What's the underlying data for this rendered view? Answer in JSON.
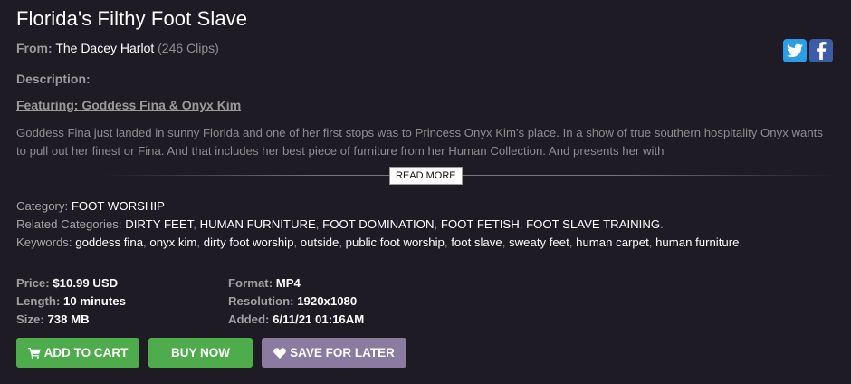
{
  "title": "Florida's Filthy Foot Slave",
  "from": {
    "label": "From:",
    "studio": "The Dacey Harlot",
    "clips": "(246 Clips)"
  },
  "social": {
    "twitter_icon": "twitter-icon",
    "facebook_icon": "facebook-icon"
  },
  "description": {
    "label": "Description:",
    "featuring": "Featuring: Goddess Fina & Onyx Kim",
    "text": "Goddess Fina just landed in sunny Florida and one of her first stops was to Princess Onyx Kim's place.  In a show of true southern hospitality Onyx wants to pull out her finest or Fina.  And that includes her best piece of furniture from her Human Collection.  And presents her with",
    "read_more": "READ MORE"
  },
  "category": {
    "label": "Category:",
    "value": "FOOT WORSHIP"
  },
  "related": {
    "label": "Related Categories:",
    "items": [
      "DIRTY FEET",
      "HUMAN FURNITURE",
      "FOOT DOMINATION",
      "FOOT FETISH",
      "FOOT SLAVE TRAINING"
    ]
  },
  "keywords": {
    "label": "Keywords:",
    "items": [
      "goddess fina",
      "onyx kim",
      "dirty foot worship",
      "outside",
      "public foot worship",
      "foot slave",
      "sweaty feet",
      "human carpet",
      "human furniture"
    ]
  },
  "info": {
    "price_label": "Price:",
    "price": "$10.99 USD",
    "length_label": "Length:",
    "length": "10 minutes",
    "size_label": "Size:",
    "size": "738 MB",
    "format_label": "Format:",
    "format": "MP4",
    "resolution_label": "Resolution:",
    "resolution": "1920x1080",
    "added_label": "Added:",
    "added": "6/11/21 01:16AM"
  },
  "buttons": {
    "add_to_cart": "ADD TO CART",
    "buy_now": "BUY NOW",
    "save_for_later": "SAVE FOR LATER"
  },
  "colors": {
    "background": "#1f1b24",
    "green": "#4eac4d",
    "purple": "#8c7ba0",
    "twitter": "#2a9de7",
    "facebook": "#3b5da5"
  }
}
